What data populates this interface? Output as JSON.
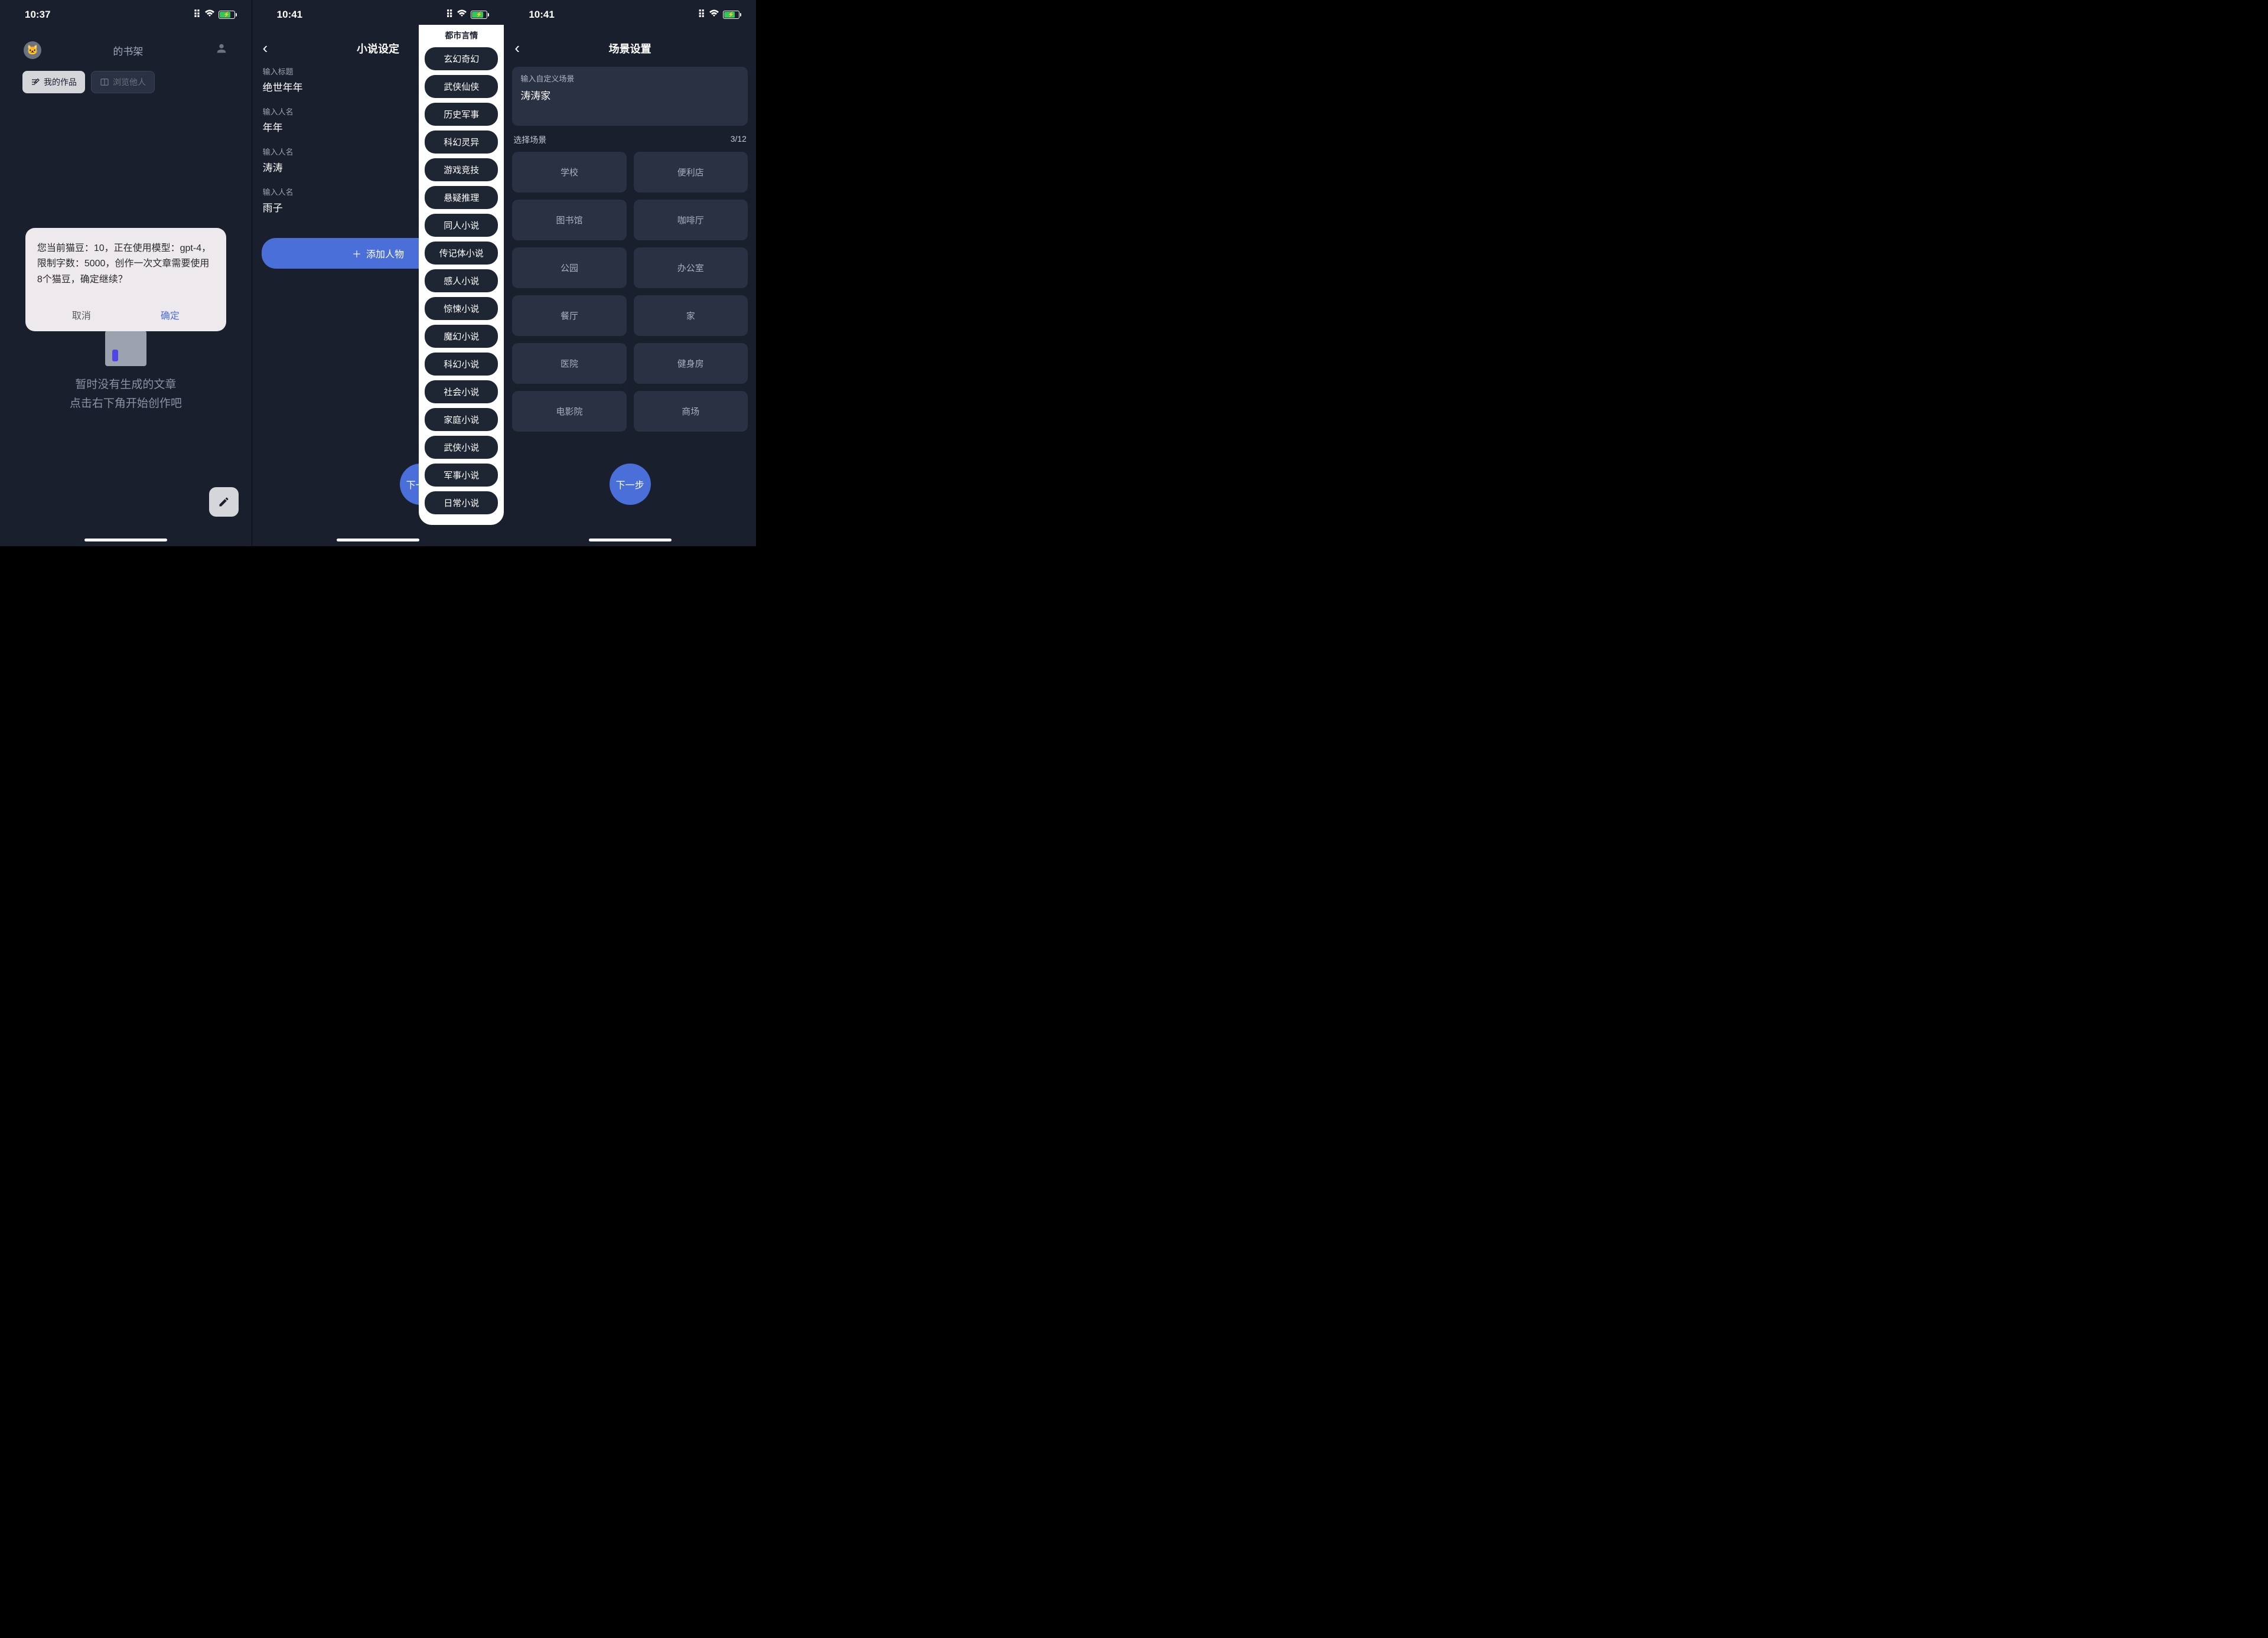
{
  "screen1": {
    "time": "10:37",
    "header_title": "的书架",
    "tab_myworks": "我的作品",
    "tab_browse": "浏览他人",
    "empty_line1": "暂时没有生成的文章",
    "empty_line2": "点击右下角开始创作吧",
    "dialog_text": "您当前猫豆：10，正在使用模型：gpt-4，限制字数：5000，创作一次文章需要使用8个猫豆，确定继续？",
    "dialog_cancel": "取消",
    "dialog_ok": "确定"
  },
  "screen2": {
    "time": "10:41",
    "title": "小说设定",
    "fields": [
      {
        "label": "输入标题",
        "value": "绝世年年"
      },
      {
        "label": "输入人名",
        "value": "年年"
      },
      {
        "label": "输入人名",
        "value": "涛涛"
      },
      {
        "label": "输入人名",
        "value": "雨子"
      }
    ],
    "add_label": "添加人物",
    "next_label": "下一步",
    "genre_peek": "都市言情",
    "genres": [
      "玄幻奇幻",
      "武侠仙侠",
      "历史军事",
      "科幻灵异",
      "游戏竞技",
      "悬疑推理",
      "同人小说",
      "传记体小说",
      "感人小说",
      "惊悚小说",
      "魔幻小说",
      "科幻小说",
      "社会小说",
      "家庭小说",
      "武侠小说",
      "军事小说",
      "日常小说"
    ]
  },
  "screen3": {
    "time": "10:41",
    "title": "场景设置",
    "input_label": "输入自定义场景",
    "input_value": "涛涛家",
    "select_label": "选择场景",
    "counter": "3/12",
    "scenes": [
      "学校",
      "便利店",
      "图书馆",
      "咖啡厅",
      "公园",
      "办公室",
      "餐厅",
      "家",
      "医院",
      "健身房",
      "电影院",
      "商场"
    ],
    "next_label": "下一步"
  }
}
